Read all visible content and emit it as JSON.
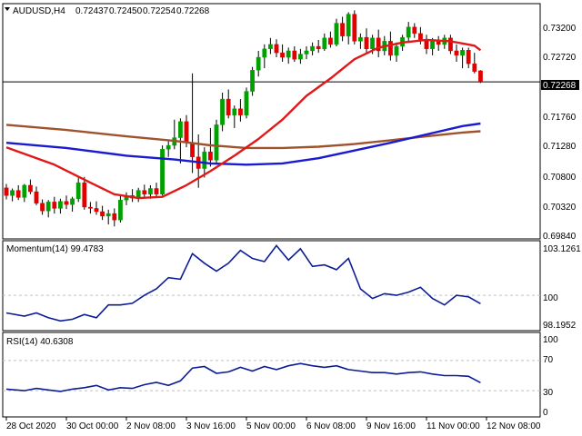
{
  "header": {
    "symbol": "AUDUSD,H4",
    "values": [
      "0.72437",
      "0.72450",
      "0.72254",
      "0.72268"
    ]
  },
  "colors": {
    "bull": "#00a000",
    "bear": "#e00000",
    "ma_fast": "#e01818",
    "ma_mid": "#1a1ad0",
    "ma_slow": "#a0522d",
    "indicator": "#0b1d96",
    "grid": "#c0c0c0",
    "price_tag_bg": "#000000",
    "price_tag_fg": "#ffffff"
  },
  "chart_data": [
    {
      "type": "candlestick",
      "title": "AUDUSD,H4",
      "ylim": [
        0.6984,
        0.7347
      ],
      "y_ticks": [
        "0.73200",
        "0.72720",
        "0.72268",
        "0.71760",
        "0.71280",
        "0.70800",
        "0.70320",
        "0.69840"
      ],
      "current_price": "0.72268",
      "candles": [
        [
          0.7062,
          0.7068,
          0.7044,
          0.705
        ],
        [
          0.705,
          0.7061,
          0.7041,
          0.7058
        ],
        [
          0.7058,
          0.7066,
          0.7043,
          0.7047
        ],
        [
          0.7047,
          0.7068,
          0.704,
          0.7066
        ],
        [
          0.7066,
          0.7075,
          0.7052,
          0.7056
        ],
        [
          0.7056,
          0.7064,
          0.7035,
          0.7038
        ],
        [
          0.7038,
          0.7044,
          0.702,
          0.7026
        ],
        [
          0.7026,
          0.7043,
          0.7016,
          0.704
        ],
        [
          0.704,
          0.7048,
          0.7022,
          0.703
        ],
        [
          0.703,
          0.7045,
          0.7022,
          0.7041
        ],
        [
          0.7041,
          0.705,
          0.7029,
          0.7036
        ],
        [
          0.7036,
          0.7048,
          0.7025,
          0.7045
        ],
        [
          0.7045,
          0.7078,
          0.704,
          0.707
        ],
        [
          0.707,
          0.7079,
          0.7028,
          0.7032
        ],
        [
          0.7032,
          0.704,
          0.7022,
          0.703
        ],
        [
          0.703,
          0.7041,
          0.702,
          0.7025
        ],
        [
          0.7025,
          0.7034,
          0.7012,
          0.7018
        ],
        [
          0.7018,
          0.7028,
          0.7005,
          0.7022
        ],
        [
          0.7022,
          0.703,
          0.7002,
          0.7012
        ],
        [
          0.7012,
          0.705,
          0.7008,
          0.7043
        ],
        [
          0.7043,
          0.7055,
          0.7035,
          0.705
        ],
        [
          0.705,
          0.706,
          0.704,
          0.7046
        ],
        [
          0.7046,
          0.7062,
          0.704,
          0.7058
        ],
        [
          0.7058,
          0.7067,
          0.7048,
          0.7052
        ],
        [
          0.7052,
          0.7066,
          0.7045,
          0.7061
        ],
        [
          0.7061,
          0.707,
          0.7048,
          0.7052
        ],
        [
          0.7052,
          0.7128,
          0.705,
          0.7122
        ],
        [
          0.7122,
          0.7135,
          0.711,
          0.7128
        ],
        [
          0.7128,
          0.7168,
          0.7122,
          0.714
        ],
        [
          0.714,
          0.717,
          0.71,
          0.7165
        ],
        [
          0.7165,
          0.7175,
          0.7125,
          0.7132
        ],
        [
          0.7132,
          0.724,
          0.7085,
          0.711
        ],
        [
          0.711,
          0.7145,
          0.7062,
          0.7092
        ],
        [
          0.7092,
          0.7125,
          0.7078,
          0.7118
        ],
        [
          0.7118,
          0.7155,
          0.7095,
          0.7105
        ],
        [
          0.7105,
          0.7168,
          0.7098,
          0.716
        ],
        [
          0.716,
          0.721,
          0.715,
          0.72
        ],
        [
          0.72,
          0.7215,
          0.717,
          0.7175
        ],
        [
          0.7175,
          0.719,
          0.7155,
          0.7185
        ],
        [
          0.7185,
          0.72,
          0.7165,
          0.7175
        ],
        [
          0.7175,
          0.7218,
          0.717,
          0.7212
        ],
        [
          0.7212,
          0.725,
          0.7205,
          0.7245
        ],
        [
          0.7245,
          0.7275,
          0.7235,
          0.7265
        ],
        [
          0.7265,
          0.7285,
          0.7248,
          0.7278
        ],
        [
          0.7278,
          0.7295,
          0.727,
          0.7285
        ],
        [
          0.7285,
          0.7293,
          0.7265,
          0.7272
        ],
        [
          0.7272,
          0.7285,
          0.7258,
          0.7265
        ],
        [
          0.7265,
          0.728,
          0.7255,
          0.7275
        ],
        [
          0.7275,
          0.7282,
          0.7258,
          0.7262
        ],
        [
          0.7262,
          0.7278,
          0.7255,
          0.727
        ],
        [
          0.727,
          0.7282,
          0.7262,
          0.7275
        ],
        [
          0.7275,
          0.7288,
          0.7268,
          0.7282
        ],
        [
          0.7282,
          0.7292,
          0.7272,
          0.7278
        ],
        [
          0.7278,
          0.7302,
          0.7275,
          0.7295
        ],
        [
          0.7295,
          0.7305,
          0.728,
          0.7285
        ],
        [
          0.7285,
          0.7325,
          0.7282,
          0.7318
        ],
        [
          0.7318,
          0.7328,
          0.729,
          0.7298
        ],
        [
          0.7298,
          0.7335,
          0.7285,
          0.7332
        ],
        [
          0.7332,
          0.7338,
          0.7285,
          0.729
        ],
        [
          0.729,
          0.7302,
          0.7278,
          0.7296
        ],
        [
          0.7296,
          0.731,
          0.727,
          0.7278
        ],
        [
          0.7278,
          0.73,
          0.727,
          0.7295
        ],
        [
          0.7295,
          0.7308,
          0.7265,
          0.7275
        ],
        [
          0.7275,
          0.7298,
          0.7268,
          0.729
        ],
        [
          0.729,
          0.7305,
          0.726,
          0.7268
        ],
        [
          0.7268,
          0.7288,
          0.7258,
          0.7282
        ],
        [
          0.7282,
          0.73,
          0.7275,
          0.7296
        ],
        [
          0.7296,
          0.732,
          0.729,
          0.7312
        ],
        [
          0.7312,
          0.7318,
          0.7295,
          0.7302
        ],
        [
          0.7302,
          0.7312,
          0.7285,
          0.7292
        ],
        [
          0.7292,
          0.73,
          0.727,
          0.7278
        ],
        [
          0.7278,
          0.7295,
          0.7268,
          0.729
        ],
        [
          0.729,
          0.7298,
          0.7275,
          0.7285
        ],
        [
          0.7285,
          0.73,
          0.7278,
          0.7295
        ],
        [
          0.7295,
          0.73,
          0.727,
          0.7275
        ],
        [
          0.7275,
          0.7285,
          0.7258,
          0.7268
        ],
        [
          0.7268,
          0.728,
          0.7248,
          0.7276
        ],
        [
          0.7276,
          0.728,
          0.7248,
          0.7255
        ],
        [
          0.7255,
          0.7272,
          0.724,
          0.7243
        ],
        [
          0.7244,
          0.7245,
          0.7225,
          0.7227
        ]
      ],
      "ma_fast": [
        [
          0,
          0.7125
        ],
        [
          8,
          0.7098
        ],
        [
          14,
          0.707
        ],
        [
          18,
          0.7052
        ],
        [
          22,
          0.7046
        ],
        [
          26,
          0.7048
        ],
        [
          30,
          0.7066
        ],
        [
          34,
          0.7088
        ],
        [
          38,
          0.7112
        ],
        [
          42,
          0.7138
        ],
        [
          46,
          0.7168
        ],
        [
          50,
          0.7205
        ],
        [
          54,
          0.7232
        ],
        [
          58,
          0.7262
        ],
        [
          62,
          0.728
        ],
        [
          66,
          0.7288
        ],
        [
          70,
          0.7292
        ],
        [
          74,
          0.729
        ],
        [
          78,
          0.7283
        ],
        [
          79,
          0.7276
        ]
      ],
      "ma_mid": [
        [
          0,
          0.7132
        ],
        [
          10,
          0.7124
        ],
        [
          20,
          0.7112
        ],
        [
          28,
          0.7106
        ],
        [
          34,
          0.71
        ],
        [
          40,
          0.7098
        ],
        [
          46,
          0.71
        ],
        [
          52,
          0.7108
        ],
        [
          58,
          0.712
        ],
        [
          64,
          0.7132
        ],
        [
          70,
          0.7145
        ],
        [
          76,
          0.7158
        ],
        [
          79,
          0.7162
        ]
      ],
      "ma_slow": [
        [
          0,
          0.716
        ],
        [
          10,
          0.7152
        ],
        [
          20,
          0.7142
        ],
        [
          28,
          0.7135
        ],
        [
          34,
          0.7128
        ],
        [
          40,
          0.7124
        ],
        [
          46,
          0.7124
        ],
        [
          52,
          0.7126
        ],
        [
          58,
          0.713
        ],
        [
          64,
          0.7136
        ],
        [
          70,
          0.7142
        ],
        [
          76,
          0.7148
        ],
        [
          79,
          0.715
        ]
      ]
    },
    {
      "type": "line",
      "title": "Momentum(14) 99.4783",
      "ylim": [
        97.85,
        103.35
      ],
      "y_ticks": [
        "103.1261",
        "100",
        "98.1952"
      ],
      "reference_line": 100,
      "x": [
        0,
        3,
        5,
        7,
        9,
        11,
        13,
        15,
        17,
        19,
        21,
        23,
        25,
        27,
        29,
        31,
        33,
        35,
        37,
        39,
        41,
        43,
        45,
        47,
        49,
        51,
        53,
        55,
        57,
        59,
        61,
        63,
        65,
        67,
        69,
        71,
        73,
        75,
        77,
        79
      ],
      "y": [
        98.9,
        98.7,
        98.9,
        98.6,
        98.4,
        98.5,
        98.8,
        98.6,
        99.4,
        99.4,
        99.5,
        100.0,
        100.4,
        101.1,
        101.0,
        102.6,
        102.0,
        101.5,
        102.0,
        102.8,
        102.3,
        102.1,
        103.1,
        102.2,
        102.9,
        101.8,
        101.9,
        101.6,
        102.3,
        100.4,
        99.8,
        100.1,
        100.0,
        100.2,
        100.5,
        99.8,
        99.4,
        100.0,
        99.9,
        99.48
      ]
    },
    {
      "type": "line",
      "title": "RSI(14) 40.6308",
      "ylim": [
        0,
        100
      ],
      "y_ticks": [
        "100",
        "70",
        "30",
        "0"
      ],
      "levels": [
        70,
        30
      ],
      "x": [
        0,
        3,
        5,
        7,
        9,
        11,
        13,
        15,
        17,
        19,
        21,
        23,
        25,
        27,
        29,
        31,
        33,
        35,
        37,
        39,
        41,
        43,
        45,
        47,
        49,
        51,
        53,
        55,
        57,
        59,
        61,
        63,
        65,
        67,
        69,
        71,
        73,
        75,
        77,
        79
      ],
      "y": [
        32,
        30,
        33,
        31,
        29,
        32,
        34,
        37,
        31,
        34,
        33,
        38,
        41,
        37,
        43,
        60,
        62,
        53,
        55,
        61,
        56,
        62,
        58,
        63,
        66,
        63,
        61,
        63,
        58,
        56,
        54,
        54,
        52,
        54,
        55,
        52,
        50,
        50,
        49,
        40.63
      ]
    }
  ],
  "time_axis": {
    "labels": [
      "28 Oct 2020",
      "30 Oct 00:00",
      "2 Nov 08:00",
      "3 Nov 16:00",
      "5 Nov 00:00",
      "6 Nov 08:00",
      "9 Nov 16:00",
      "11 Nov 00:00",
      "12 Nov 08:00"
    ],
    "label_bars": [
      0,
      10,
      20,
      30,
      40,
      50,
      60,
      70,
      80
    ]
  }
}
